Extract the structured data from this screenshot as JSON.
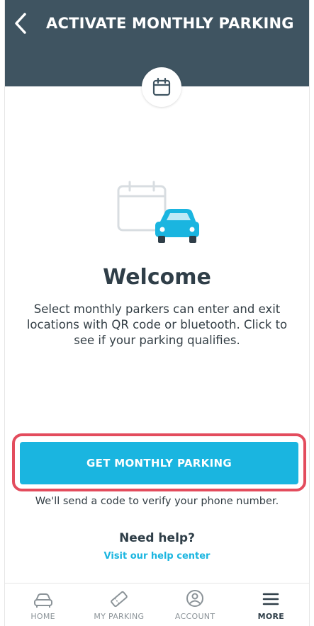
{
  "header": {
    "title": "ACTIVATE MONTHLY PARKING"
  },
  "main": {
    "welcome": "Welcome",
    "description": "Select monthly parkers can enter and exit locations with QR code or bluetooth. Click to see if your parking qualifies.",
    "cta_label": "GET MONTHLY PARKING",
    "verify_note": "We'll send a code to verify your phone number.",
    "help_heading": "Need help?",
    "help_link": "Visit our help center"
  },
  "nav": {
    "items": [
      {
        "label": "HOME",
        "icon": "car-icon",
        "active": false
      },
      {
        "label": "MY PARKING",
        "icon": "ticket-icon",
        "active": false
      },
      {
        "label": "ACCOUNT",
        "icon": "user-icon",
        "active": false
      },
      {
        "label": "MORE",
        "icon": "menu-icon",
        "active": true
      }
    ]
  },
  "colors": {
    "header_bg": "#3f5461",
    "accent": "#1ab5e0",
    "highlight": "#e34c5d",
    "text_dark": "#2f3e48"
  }
}
